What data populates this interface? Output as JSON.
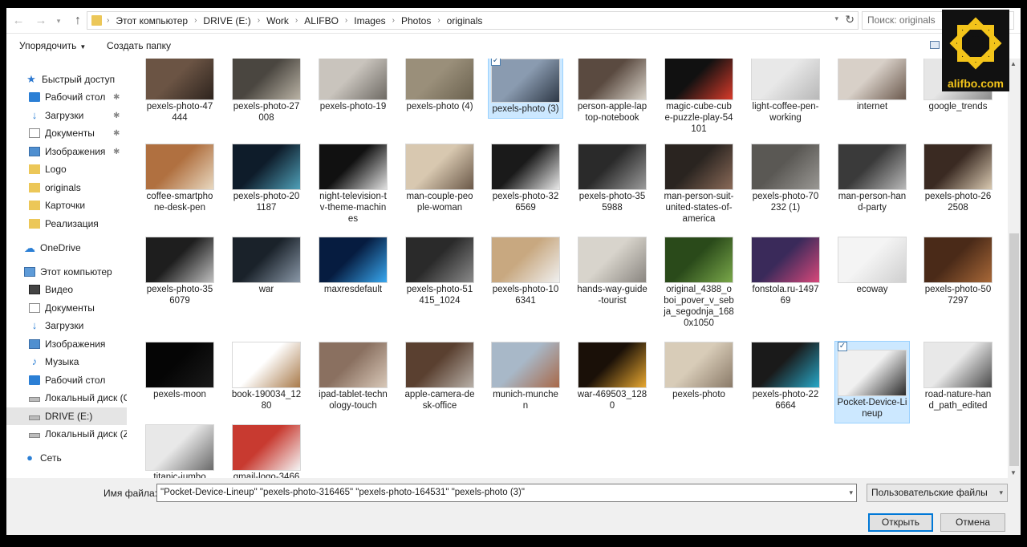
{
  "address": {
    "back_icon": "arrow-left-icon",
    "forward_icon": "arrow-right-icon",
    "up_icon": "arrow-up-icon",
    "crumbs": [
      "Этот компьютер",
      "DRIVE (E:)",
      "Work",
      "ALIFBO",
      "Images",
      "Photos",
      "originals"
    ],
    "search_placeholder": "Поиск: originals"
  },
  "toolbar": {
    "organize_label": "Упорядочить",
    "new_folder_label": "Создать папку"
  },
  "sidebar": {
    "items": [
      {
        "label": "Быстрый доступ",
        "icon": "star-icon"
      },
      {
        "label": "Рабочий стол",
        "icon": "desktop-icon",
        "pinned": true
      },
      {
        "label": "Загрузки",
        "icon": "download-icon",
        "pinned": true
      },
      {
        "label": "Документы",
        "icon": "document-icon",
        "pinned": true
      },
      {
        "label": "Изображения",
        "icon": "pictures-icon",
        "pinned": true
      },
      {
        "label": "Logo",
        "icon": "folder-icon"
      },
      {
        "label": "originals",
        "icon": "folder-icon"
      },
      {
        "label": "Карточки",
        "icon": "folder-icon"
      },
      {
        "label": "Реализация",
        "icon": "folder-icon"
      },
      {
        "label": "OneDrive",
        "icon": "cloud-icon"
      },
      {
        "label": "Этот компьютер",
        "icon": "computer-icon"
      },
      {
        "label": "Видео",
        "icon": "video-icon"
      },
      {
        "label": "Документы",
        "icon": "document-icon"
      },
      {
        "label": "Загрузки",
        "icon": "download-icon"
      },
      {
        "label": "Изображения",
        "icon": "pictures-icon"
      },
      {
        "label": "Музыка",
        "icon": "music-icon"
      },
      {
        "label": "Рабочий стол",
        "icon": "desktop-icon"
      },
      {
        "label": "Локальный диск (C",
        "icon": "drive-icon"
      },
      {
        "label": "DRIVE (E:)",
        "icon": "drive-icon",
        "selected": true
      },
      {
        "label": "Локальный диск (Z",
        "icon": "drive-icon"
      },
      {
        "label": "Сеть",
        "icon": "network-icon"
      }
    ]
  },
  "files": [
    {
      "label": "pexels-photo-47444",
      "colors": [
        "#6b5444",
        "#2e241e"
      ]
    },
    {
      "label": "pexels-photo-27008",
      "colors": [
        "#4a4640",
        "#b9b2a4"
      ]
    },
    {
      "label": "pexels-photo-19",
      "colors": [
        "#c9c4bd",
        "#6e6a64"
      ]
    },
    {
      "label": "pexels-photo (4)",
      "colors": [
        "#9a8f7a",
        "#6b624f"
      ]
    },
    {
      "label": "pexels-photo (3)",
      "colors": [
        "#8a9bb0",
        "#2e3846"
      ],
      "selected": true
    },
    {
      "label": "person-apple-laptop-notebook",
      "colors": [
        "#5a4a40",
        "#d8d2c8"
      ]
    },
    {
      "label": "magic-cube-cube-puzzle-play-54101",
      "colors": [
        "#111111",
        "#d83a2a"
      ]
    },
    {
      "label": "light-coffee-pen-working",
      "colors": [
        "#e8e8e8",
        "#b8b8b8"
      ]
    },
    {
      "label": "internet",
      "colors": [
        "#d8d0c8",
        "#6c5a4e"
      ]
    },
    {
      "label": "google_trends",
      "colors": [
        "#e6e6e6",
        "#8a8a8a"
      ]
    },
    {
      "label": "coffee-smartphone-desk-pen",
      "colors": [
        "#b07040",
        "#e8d8c0"
      ]
    },
    {
      "label": "pexels-photo-201187",
      "colors": [
        "#0e1c2a",
        "#4fa0b8"
      ]
    },
    {
      "label": "night-television-tv-theme-machines",
      "colors": [
        "#111111",
        "#e0e0e0"
      ]
    },
    {
      "label": "man-couple-people-woman",
      "colors": [
        "#d8c8b0",
        "#6a5848"
      ]
    },
    {
      "label": "pexels-photo-326569",
      "colors": [
        "#1a1a1a",
        "#e8e8e8"
      ]
    },
    {
      "label": "pexels-photo-355988",
      "colors": [
        "#2a2a2a",
        "#9a9a9a"
      ]
    },
    {
      "label": "man-person-suit-united-states-of-america",
      "colors": [
        "#2a2420",
        "#8a6a58"
      ]
    },
    {
      "label": "pexels-photo-70232 (1)",
      "colors": [
        "#5a5854",
        "#9a9894"
      ]
    },
    {
      "label": "man-person-hand-party",
      "colors": [
        "#3a3a3a",
        "#b8b8b8"
      ]
    },
    {
      "label": "pexels-photo-262508",
      "colors": [
        "#3a2a22",
        "#d8c8b0"
      ]
    },
    {
      "label": "pexels-photo-356079",
      "colors": [
        "#1e1e1e",
        "#bfbfbf"
      ]
    },
    {
      "label": "war",
      "colors": [
        "#1a222a",
        "#8a98a8"
      ]
    },
    {
      "label": "maxresdefault",
      "colors": [
        "#061c40",
        "#38a8f0"
      ]
    },
    {
      "label": "pexels-photo-51415_1024",
      "colors": [
        "#2a2a2a",
        "#8a8a8a"
      ]
    },
    {
      "label": "pexels-photo-106341",
      "colors": [
        "#c8a880",
        "#f0f0f0"
      ]
    },
    {
      "label": "hands-way-guide-tourist",
      "colors": [
        "#d8d4cc",
        "#8a8680"
      ]
    },
    {
      "label": "original_4388_oboi_pover_v_sebja_segodnja_1680x1050",
      "colors": [
        "#2a4a1a",
        "#7aa84a"
      ]
    },
    {
      "label": "fonstola.ru-149769",
      "colors": [
        "#3a2a5a",
        "#d8487a"
      ]
    },
    {
      "label": "ecoway",
      "colors": [
        "#f4f4f4",
        "#cfcfcf"
      ]
    },
    {
      "label": "pexels-photo-507297",
      "colors": [
        "#4a2a18",
        "#a86838"
      ]
    },
    {
      "label": "pexels-moon",
      "colors": [
        "#050505",
        "#1a1a1a"
      ]
    },
    {
      "label": "book-190034_1280",
      "colors": [
        "#ffffff",
        "#a87a4a"
      ]
    },
    {
      "label": "ipad-tablet-technology-touch",
      "colors": [
        "#8a7060",
        "#d8c8b8"
      ]
    },
    {
      "label": "apple-camera-desk-office",
      "colors": [
        "#5a4030",
        "#b8b0a8"
      ]
    },
    {
      "label": "munich-munchen",
      "colors": [
        "#a8b8c8",
        "#a86848"
      ]
    },
    {
      "label": "war-469503_1280",
      "colors": [
        "#1a1008",
        "#e8a830"
      ]
    },
    {
      "label": "pexels-photo",
      "colors": [
        "#d8ccb8",
        "#8a7a68"
      ]
    },
    {
      "label": "pexels-photo-226664",
      "colors": [
        "#1a1a1a",
        "#28a8c8"
      ]
    },
    {
      "label": "Pocket-Device-Lineup",
      "colors": [
        "#f0f0f0",
        "#2a2a2a"
      ],
      "selected": true
    },
    {
      "label": "road-nature-hand_path_edited",
      "colors": [
        "#e8e8e8",
        "#4a4a4a"
      ]
    },
    {
      "label": "titanic-jumbo",
      "colors": [
        "#e8e8e8",
        "#6a6a6a"
      ]
    },
    {
      "label": "gmail-logo-3466",
      "colors": [
        "#c83a30",
        "#f4f4f4"
      ]
    }
  ],
  "filename": {
    "label": "Имя файла:",
    "value": "\"Pocket-Device-Lineup\" \"pexels-photo-316465\" \"pexels-photo-164531\" \"pexels-photo (3)\""
  },
  "filetype": {
    "value": "Пользовательские файлы"
  },
  "buttons": {
    "open": "Открыть",
    "cancel": "Отмена"
  },
  "logo": {
    "text": "alifbo.com",
    "accent": "#f3c41a"
  }
}
